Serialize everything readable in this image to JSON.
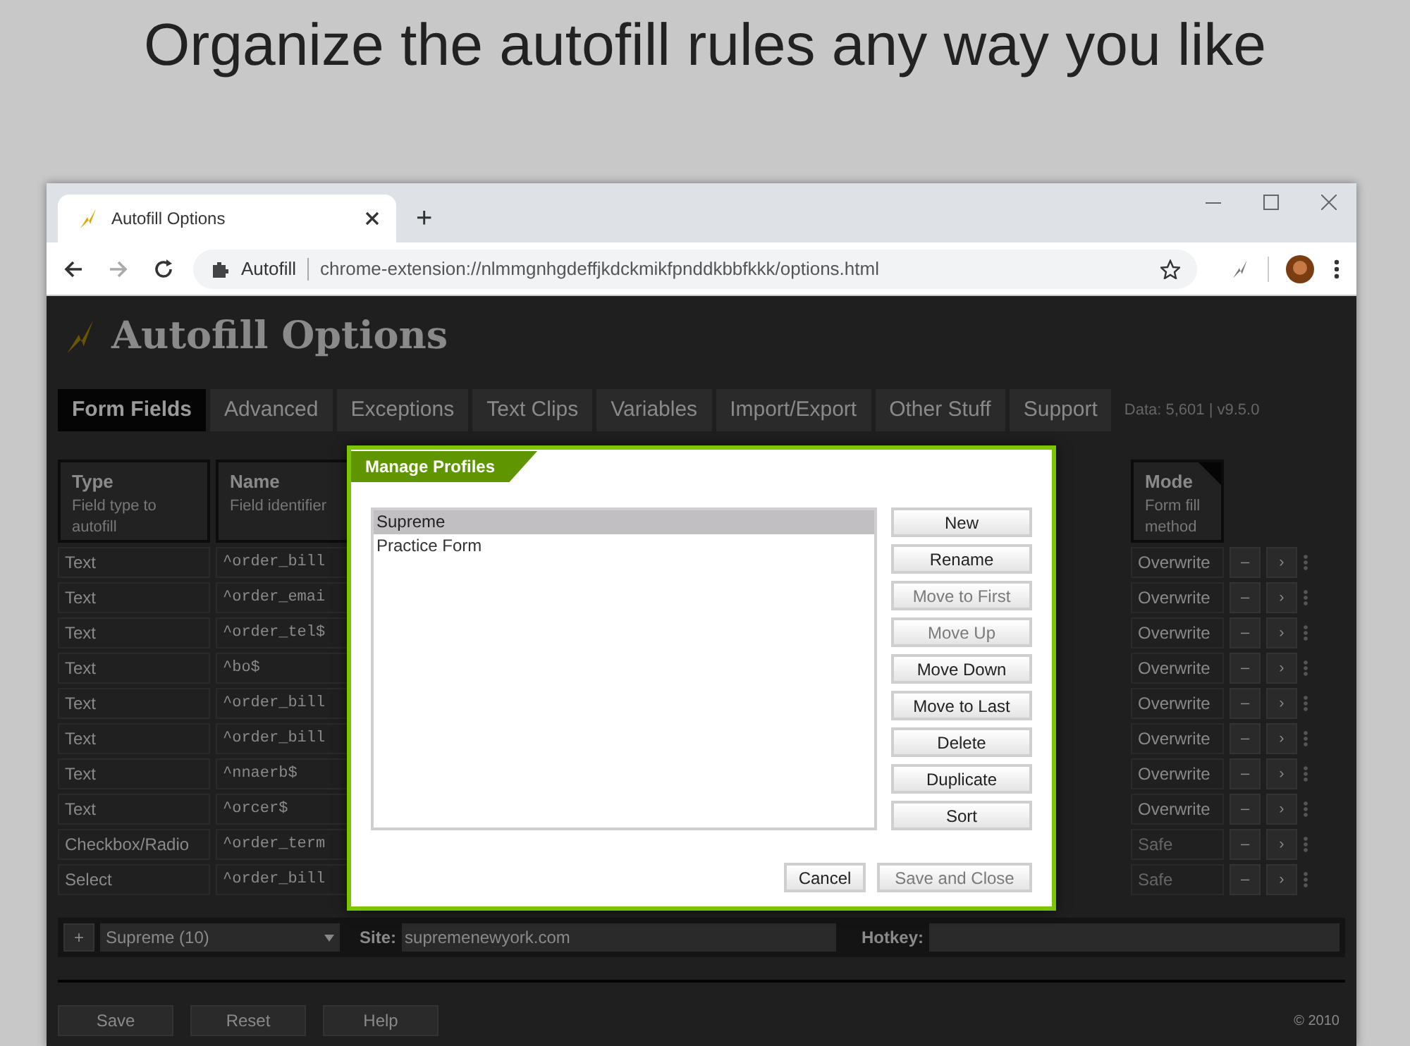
{
  "headline": "Organize the autofill rules any way you like",
  "browser": {
    "tab_title": "Autofill Options",
    "new_tab": "+",
    "site_chip": "Autofill",
    "url": "chrome-extension://nlmmgnhgdeffjkdckmikfpnddkbbfkkk/options.html"
  },
  "page": {
    "title": "Autofill Options",
    "tabs": [
      {
        "label": "Form Fields",
        "selected": true
      },
      {
        "label": "Advanced",
        "selected": false
      },
      {
        "label": "Exceptions",
        "selected": false
      },
      {
        "label": "Text Clips",
        "selected": false
      },
      {
        "label": "Variables",
        "selected": false
      },
      {
        "label": "Import/Export",
        "selected": false
      },
      {
        "label": "Other Stuff",
        "selected": false
      },
      {
        "label": "Support",
        "selected": false
      }
    ],
    "info": "Data: 5,601 | v9.5.0",
    "columns": [
      {
        "title": "Type",
        "hint": "Field type to autofill"
      },
      {
        "title": "Name",
        "hint": "Field identifier"
      },
      {
        "title": "Mode",
        "hint": "Form fill method"
      }
    ],
    "rows": [
      {
        "type": "Text",
        "name": "^order_bill",
        "mode": "Overwrite",
        "disabled": false
      },
      {
        "type": "Text",
        "name": "^order_emai",
        "mode": "Overwrite",
        "disabled": false
      },
      {
        "type": "Text",
        "name": "^order_tel$",
        "mode": "Overwrite",
        "disabled": false
      },
      {
        "type": "Text",
        "name": "^bo$",
        "mode": "Overwrite",
        "disabled": false
      },
      {
        "type": "Text",
        "name": "^order_bill",
        "mode": "Overwrite",
        "disabled": false
      },
      {
        "type": "Text",
        "name": "^order_bill",
        "mode": "Overwrite",
        "disabled": false
      },
      {
        "type": "Text",
        "name": "^nnaerb$",
        "mode": "Overwrite",
        "disabled": false
      },
      {
        "type": "Text",
        "name": "^orcer$",
        "mode": "Overwrite",
        "disabled": false
      },
      {
        "type": "Checkbox/Radio",
        "name": "^order_term",
        "mode": "Safe",
        "disabled": true
      },
      {
        "type": "Select",
        "name": "^order_bill",
        "mode": "Safe",
        "disabled": true
      }
    ],
    "row_buttons": [
      "–",
      "›"
    ],
    "footer": {
      "add": "+",
      "profile": "Supreme (10)",
      "site_label": "Site:",
      "site_value": "supremenewyork.com",
      "hotkey_label": "Hotkey:"
    },
    "actions": [
      "Save",
      "Reset",
      "Help"
    ],
    "copyright": "© 2010"
  },
  "dialog": {
    "title": "Manage Profiles",
    "profiles": [
      {
        "label": "Supreme",
        "selected": true
      },
      {
        "label": "Practice Form",
        "selected": false
      }
    ],
    "buttons": [
      {
        "label": "New",
        "disabled": false
      },
      {
        "label": "Rename",
        "disabled": false
      },
      {
        "label": "Move to First",
        "disabled": true
      },
      {
        "label": "Move Up",
        "disabled": true
      },
      {
        "label": "Move Down",
        "disabled": false
      },
      {
        "label": "Move to Last",
        "disabled": false
      },
      {
        "label": "Delete",
        "disabled": false
      },
      {
        "label": "Duplicate",
        "disabled": false
      },
      {
        "label": "Sort",
        "disabled": false
      }
    ],
    "footer_buttons": [
      {
        "label": "Cancel",
        "disabled": false
      },
      {
        "label": "Save and Close",
        "disabled": true
      }
    ]
  }
}
